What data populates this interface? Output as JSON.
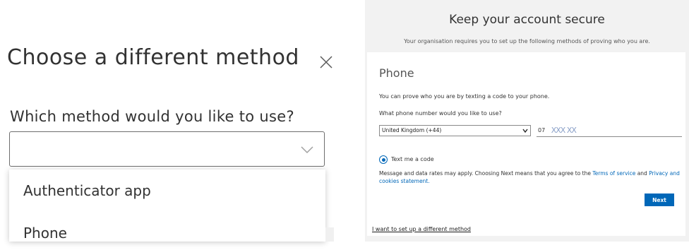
{
  "dialog": {
    "title": "Choose a different method",
    "question": "Which method would you like to use?",
    "select_value": "",
    "options": [
      "Authenticator app",
      "Phone"
    ]
  },
  "page": {
    "title": "Keep your account secure",
    "subtitle": "Your organisation requires you to set up the following methods of proving who you are.",
    "card_title": "Phone",
    "description": "You can prove who you are by texting a code to your phone.",
    "phone_question": "What phone number would you like to use?",
    "country": "United Kingdom (+44)",
    "phone_prefix": "07",
    "phone_masked": "XXX XX",
    "radio_label": "Text me a code",
    "legal_prefix": "Message and data rates may apply. Choosing Next means that you agree to the ",
    "terms_link": "Terms of service",
    "legal_and": " and ",
    "privacy_link": "Privacy and cookies statement.",
    "next_label": "Next",
    "different_method_link": "I want to set up a different method"
  },
  "colors": {
    "accent": "#0067b8",
    "panel_bg": "#f2f2f2"
  }
}
